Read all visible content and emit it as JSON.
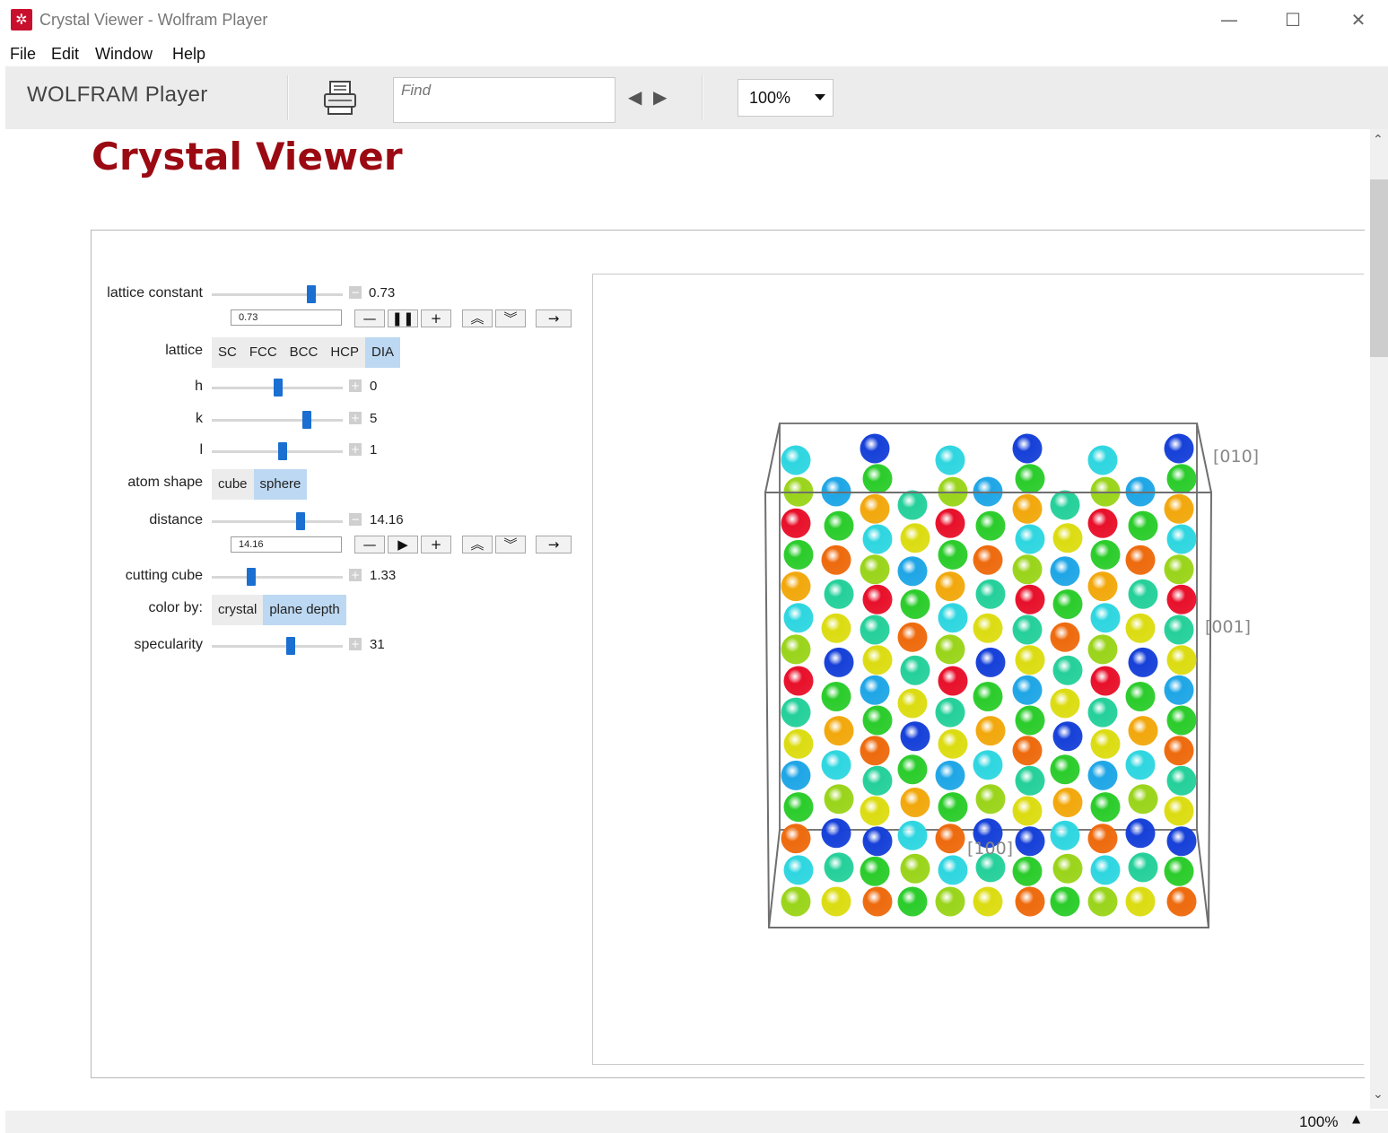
{
  "window": {
    "title": "Crystal Viewer - Wolfram Player",
    "minimize": "—",
    "maximize": "☐",
    "close": "✕"
  },
  "menu": [
    "File",
    "Edit",
    "Window",
    "Help"
  ],
  "toolbar": {
    "brand": "WOLFRAM Player",
    "find_placeholder": "Find",
    "prev": "◀",
    "next": "▶",
    "zoom": "100%"
  },
  "document": {
    "title": "Crystal Viewer"
  },
  "controls": {
    "lattice_constant": {
      "label": "lattice constant",
      "value": "0.73",
      "input_value": "0.73",
      "level": 0.76
    },
    "lattice": {
      "label": "lattice",
      "options": [
        "SC",
        "FCC",
        "BCC",
        "HCP",
        "DIA"
      ],
      "selected": "DIA"
    },
    "h": {
      "label": "h",
      "value": "0",
      "level": 0.49
    },
    "k": {
      "label": "k",
      "value": "5",
      "level": 0.72
    },
    "l": {
      "label": "l",
      "value": "1",
      "level": 0.53
    },
    "atom_shape": {
      "label": "atom shape",
      "options": [
        "cube",
        "sphere"
      ],
      "selected": "sphere"
    },
    "distance": {
      "label": "distance",
      "value": "14.16",
      "input_value": "14.16",
      "level": 0.67
    },
    "cutting_cube": {
      "label": "cutting cube",
      "value": "1.33",
      "level": 0.28
    },
    "color_by": {
      "label": "color by:",
      "options": [
        "crystal",
        "plane depth"
      ],
      "selected": "plane depth"
    },
    "specularity": {
      "label": "specularity",
      "value": "31",
      "level": 0.59
    }
  },
  "anim_buttons": {
    "minus": "—",
    "pause": "❚❚",
    "play": "▶",
    "plus": "+",
    "faster": "︽",
    "slower": "︾",
    "direction": "→"
  },
  "graphic": {
    "axis_labels": [
      "[010]",
      "[001]",
      "[100]"
    ],
    "colors": {
      "red": "#e8102a",
      "orange": "#ee6a0d",
      "amber": "#f2a80c",
      "yellow": "#dcdc12",
      "yellowgreen": "#9ad41a",
      "green": "#2bcc2b",
      "teal": "#25d09a",
      "cyan": "#2ed6e0",
      "skyblue": "#1fa6e6",
      "blue": "#1640d8",
      "purple": "#8a1ad0"
    }
  },
  "status": {
    "zoom": "100%"
  }
}
